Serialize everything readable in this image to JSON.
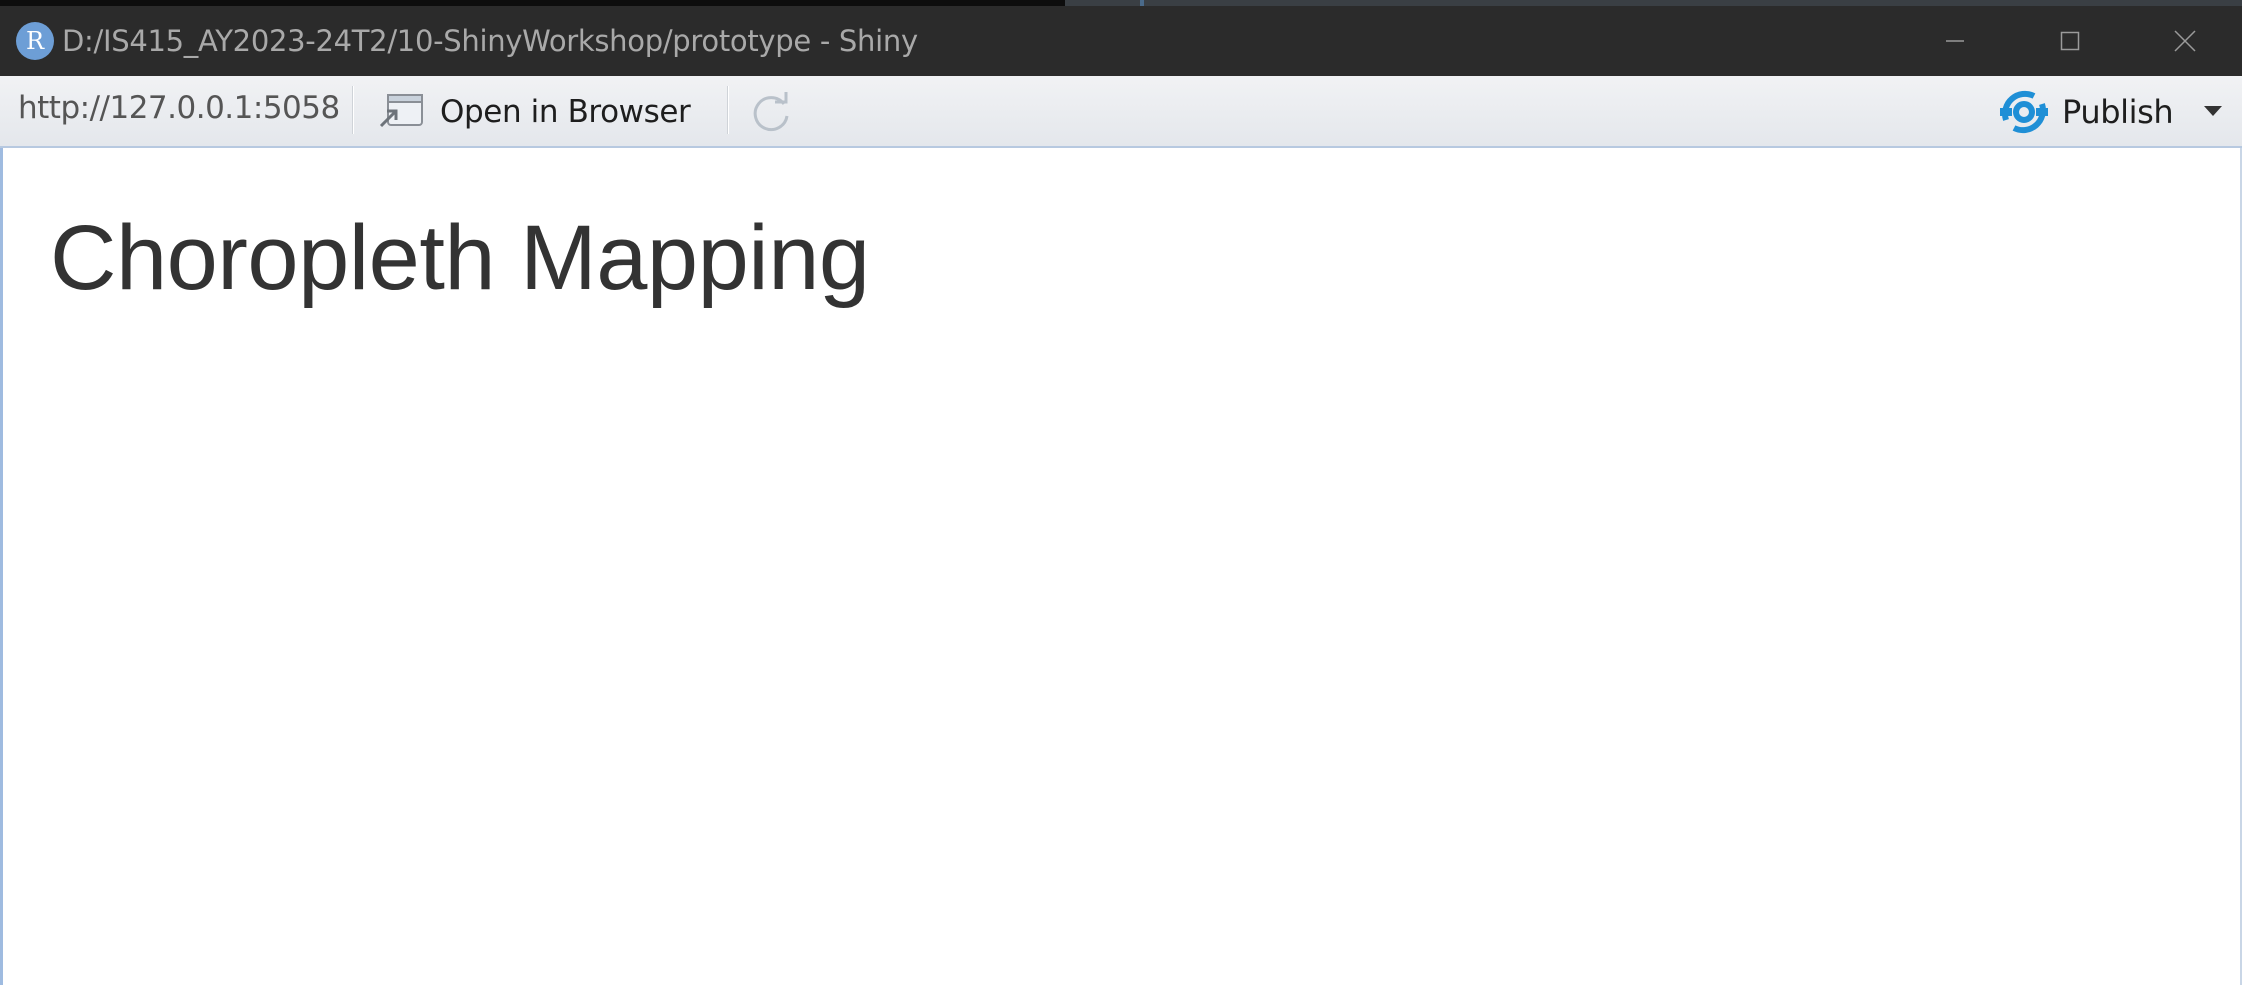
{
  "window": {
    "app_icon_letter": "R",
    "title": "D:/IS415_AY2023-24T2/10-ShinyWorkshop/prototype - Shiny"
  },
  "toolbar": {
    "url": "http://127.0.0.1:5058",
    "open_in_browser_label": "Open in Browser",
    "publish_label": "Publish"
  },
  "page": {
    "title": "Choropleth Mapping"
  },
  "colors": {
    "titlebar_bg": "#2b2b2b",
    "publish_icon": "#1f8fd6",
    "r_icon": "#6d9ed6"
  }
}
